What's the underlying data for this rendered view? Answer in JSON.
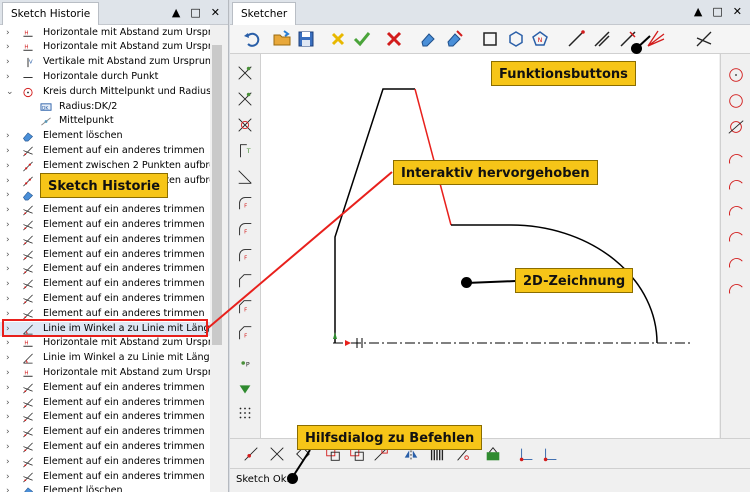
{
  "left_panel": {
    "title": "Sketch Historie",
    "controls": [
      "▲",
      "□",
      "✕"
    ],
    "items": [
      {
        "label": "Horizontale mit Abstand zum Urspr",
        "icon": "horizontal-distance-icon"
      },
      {
        "label": "Horizontale mit Abstand zum Urspr",
        "icon": "horizontal-distance-icon"
      },
      {
        "label": "Vertikale mit Abstand zum Ursprung",
        "icon": "vertical-distance-icon"
      },
      {
        "label": "Horizontale durch Punkt",
        "icon": "horizontal-line-icon"
      },
      {
        "label": "Kreis durch Mittelpunkt und Radius",
        "icon": "circle-icon"
      },
      {
        "label": "Radius:DK/2",
        "icon": "radius-icon"
      },
      {
        "label": "Mittelpunkt",
        "icon": "midpoint-icon"
      },
      {
        "label": "Element löschen",
        "icon": "eraser-icon"
      },
      {
        "label": "Element auf ein anderes trimmen",
        "icon": "trim-icon"
      },
      {
        "label": "Element zwischen 2 Punkten aufbre",
        "icon": "break-icon"
      },
      {
        "label": "Element zwischen 2 Punkten aufbre",
        "icon": "break-icon"
      },
      {
        "label": "Element löschen",
        "icon": "eraser-icon"
      },
      {
        "label": "Element auf ein anderes trimmen",
        "icon": "trim-icon"
      },
      {
        "label": "Element auf ein anderes trimmen",
        "icon": "trim-icon"
      },
      {
        "label": "Element auf ein anderes trimmen",
        "icon": "trim-icon"
      },
      {
        "label": "Element auf ein anderes trimmen",
        "icon": "trim-icon"
      },
      {
        "label": "Element auf ein anderes trimmen",
        "icon": "trim-icon"
      },
      {
        "label": "Element auf ein anderes trimmen",
        "icon": "trim-icon"
      },
      {
        "label": "Element auf ein anderes trimmen",
        "icon": "trim-icon"
      },
      {
        "label": "Element auf ein anderes trimmen",
        "icon": "trim-icon"
      },
      {
        "label": "Linie im Winkel a zu Linie mit Länge L",
        "icon": "angle-line-icon"
      },
      {
        "label": "Horizontale mit Abstand zum Urspr",
        "icon": "horizontal-distance-icon"
      },
      {
        "label": "Linie im Winkel a zu Linie mit Länge L",
        "icon": "angle-line-icon"
      },
      {
        "label": "Horizontale mit Abstand zum Urspr",
        "icon": "horizontal-distance-icon"
      },
      {
        "label": "Element auf ein anderes trimmen",
        "icon": "trim-icon"
      },
      {
        "label": "Element auf ein anderes trimmen",
        "icon": "trim-icon"
      },
      {
        "label": "Element auf ein anderes trimmen",
        "icon": "trim-icon"
      },
      {
        "label": "Element auf ein anderes trimmen",
        "icon": "trim-icon"
      },
      {
        "label": "Element auf ein anderes trimmen",
        "icon": "trim-icon"
      },
      {
        "label": "Element auf ein anderes trimmen",
        "icon": "trim-icon"
      },
      {
        "label": "Element auf ein anderes trimmen",
        "icon": "trim-icon"
      },
      {
        "label": "Element löschen",
        "icon": "eraser-icon"
      }
    ]
  },
  "sketcher": {
    "title": "Sketcher",
    "controls": [
      "▲",
      "□",
      "✕"
    ],
    "status": "Sketch Ok."
  },
  "callouts": {
    "sketch_history": "Sketch Historie",
    "function_buttons": "Funktionsbuttons",
    "highlighted": "Interaktiv hervorgehoben",
    "drawing": "2D-Zeichnung",
    "help_dialog": "Hilfsdialog zu Befehlen"
  },
  "colors": {
    "callout": "#f6c518",
    "highlight": "#e8201c",
    "geometry": "#000000"
  }
}
